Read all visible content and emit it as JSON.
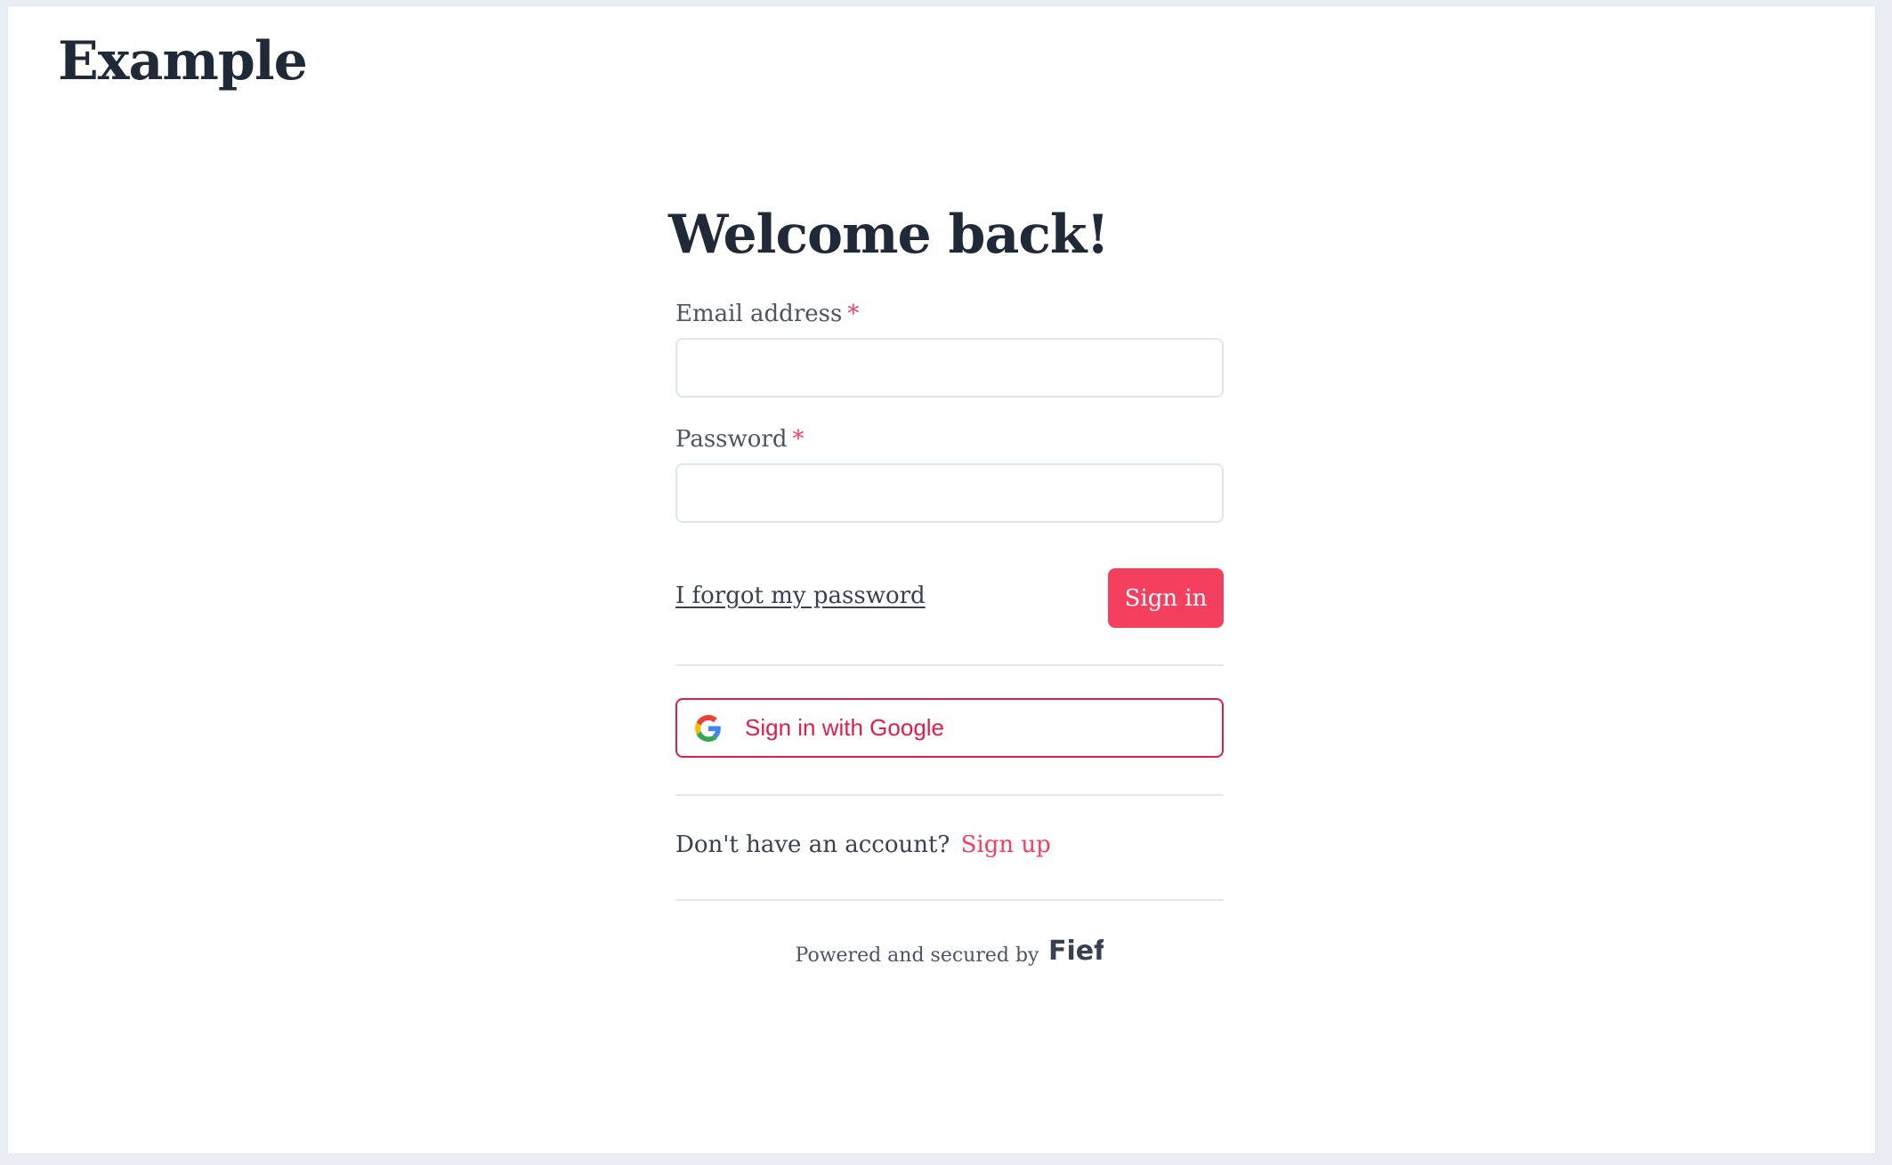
{
  "header": {
    "brand": "Example"
  },
  "login": {
    "title": "Welcome back!",
    "email_label": "Email address",
    "email_value": "",
    "password_label": "Password",
    "password_value": "",
    "required_marker": "*",
    "forgot_password": "I forgot my password",
    "sign_in": "Sign in",
    "google_sign_in": "Sign in with Google",
    "no_account_text": "Don't have an account?",
    "sign_up": "Sign up"
  },
  "footer": {
    "powered_text": "Powered and secured by",
    "logo_text": "Fief"
  },
  "colors": {
    "accent": "#f43f5e",
    "text": "#1f2937",
    "border": "#dfe5ee"
  },
  "icons": {
    "google": "google-icon",
    "fief": "fief-logo"
  }
}
